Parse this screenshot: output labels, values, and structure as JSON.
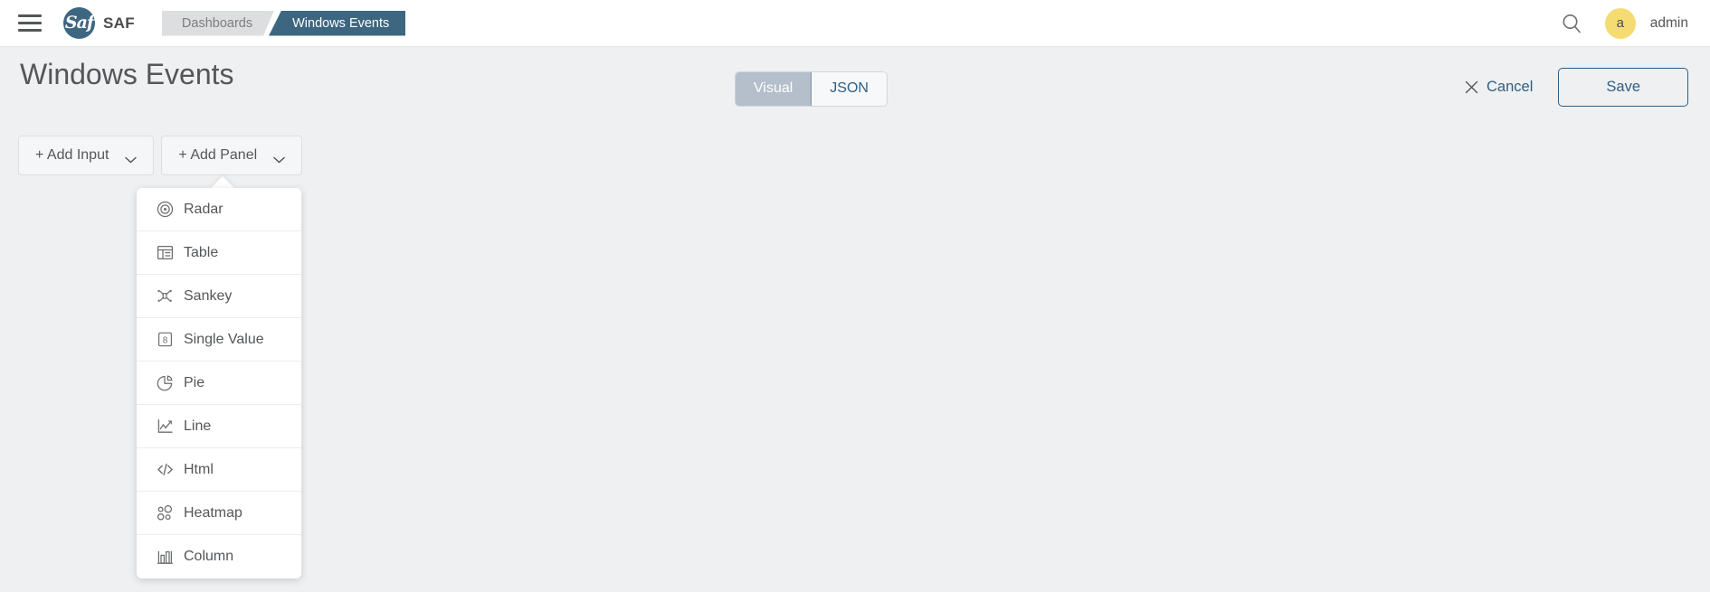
{
  "topbar": {
    "menu_icon": "hamburger-icon",
    "logo_mark": "Saf",
    "logo_text": "SAF",
    "breadcrumbs": [
      {
        "label": "Dashboards",
        "active": false
      },
      {
        "label": "Windows Events",
        "active": true
      }
    ],
    "search_icon": "search-icon",
    "avatar_initial": "a",
    "username": "admin"
  },
  "page": {
    "title": "Windows Events",
    "mode_toggle": {
      "options": [
        "Visual",
        "JSON"
      ],
      "selected": "Visual"
    },
    "actions": {
      "cancel_label": "Cancel",
      "cancel_icon": "close-icon",
      "save_label": "Save"
    }
  },
  "toolbar": {
    "buttons": [
      {
        "label": "+ Add Input",
        "icon": "chevron-down-icon",
        "expanded": false
      },
      {
        "label": "+ Add Panel",
        "icon": "chevron-down-icon",
        "expanded": true
      }
    ]
  },
  "panel_menu": {
    "open": true,
    "owner": "+ Add Panel",
    "items": [
      {
        "label": "Radar",
        "icon": "radar-icon"
      },
      {
        "label": "Table",
        "icon": "table-icon"
      },
      {
        "label": "Sankey",
        "icon": "sankey-icon"
      },
      {
        "label": "Single Value",
        "icon": "single-value-icon"
      },
      {
        "label": "Pie",
        "icon": "pie-icon"
      },
      {
        "label": "Line",
        "icon": "line-chart-icon"
      },
      {
        "label": "Html",
        "icon": "code-icon"
      },
      {
        "label": "Heatmap",
        "icon": "heatmap-icon"
      },
      {
        "label": "Column",
        "icon": "column-chart-icon"
      }
    ]
  },
  "colors": {
    "brand": "#3d6680",
    "accent_link": "#2e5f85",
    "avatar": "#f5dc72",
    "body_bg": "#eff0f2",
    "segment_active": "#b4bfcb"
  }
}
